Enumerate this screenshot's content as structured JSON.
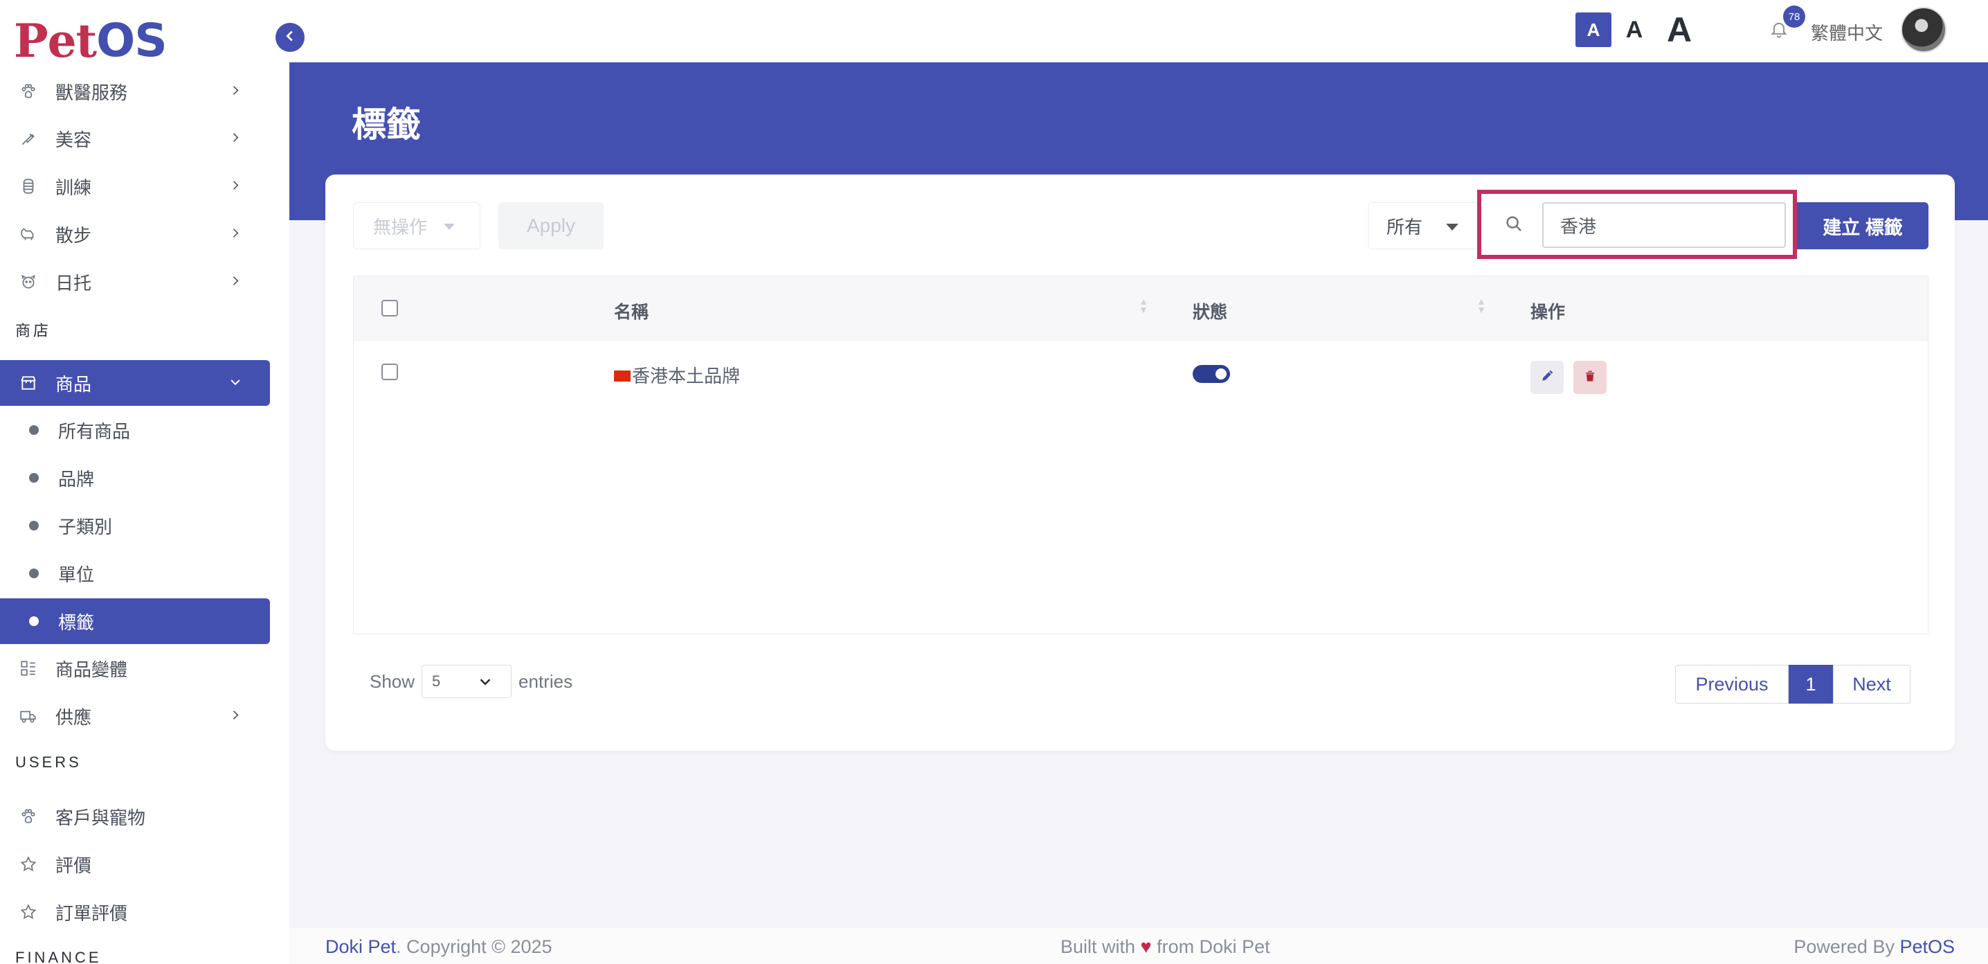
{
  "brand": {
    "logo_p": "P",
    "logo_et": "et",
    "logo_os": "OS"
  },
  "sidebar": {
    "items_top": [
      {
        "label": "獸醫服務",
        "icon": "paw-icon"
      },
      {
        "label": "美容",
        "icon": "brush-icon"
      },
      {
        "label": "訓練",
        "icon": "bone-icon"
      },
      {
        "label": "散步",
        "icon": "dog-icon"
      },
      {
        "label": "日托",
        "icon": "pet-face-icon"
      }
    ],
    "section_shop": "商店",
    "products": {
      "label": "商品",
      "icon": "store-icon"
    },
    "sub_items": [
      "所有商品",
      "品牌",
      "子類別",
      "單位",
      "標籤"
    ],
    "variants": {
      "label": "商品變體",
      "icon": "variants-icon"
    },
    "supply": {
      "label": "供應",
      "icon": "truck-icon"
    },
    "section_users": "USERS",
    "users_items": [
      {
        "label": "客戶與寵物",
        "icon": "paw-icon"
      },
      {
        "label": "評價",
        "icon": "star-icon"
      },
      {
        "label": "訂單評價",
        "icon": "star-icon"
      }
    ],
    "section_finance": "FINANCE"
  },
  "topbar": {
    "font_small": "A",
    "font_medium": "A",
    "font_large": "A",
    "notification_count": "78",
    "language": "繁體中文"
  },
  "page": {
    "title": "標籤"
  },
  "toolbar": {
    "bulk_action": "無操作",
    "apply_label": "Apply",
    "status_filter": "所有",
    "search_value": "香港",
    "create_label": "建立 標籤"
  },
  "table": {
    "headers": {
      "name": "名稱",
      "status": "狀態",
      "actions": "操作"
    },
    "rows": [
      {
        "name": "香港本土品牌",
        "flag": "hong-kong-flag-icon",
        "status": true
      }
    ]
  },
  "pagination": {
    "show_label": "Show",
    "page_size": "5",
    "entries_label": "entries",
    "previous": "Previous",
    "current": "1",
    "next": "Next"
  },
  "footer": {
    "company": "Doki Pet",
    "copyright": ". Copyright © 2025",
    "built_prefix": "Built with ",
    "built_suffix": " from Doki Pet",
    "powered_prefix": "Powered By ",
    "powered_brand": "PetOS"
  },
  "colors": {
    "primary": "#4450b0",
    "highlight": "#c1305f",
    "danger": "#b02432"
  }
}
